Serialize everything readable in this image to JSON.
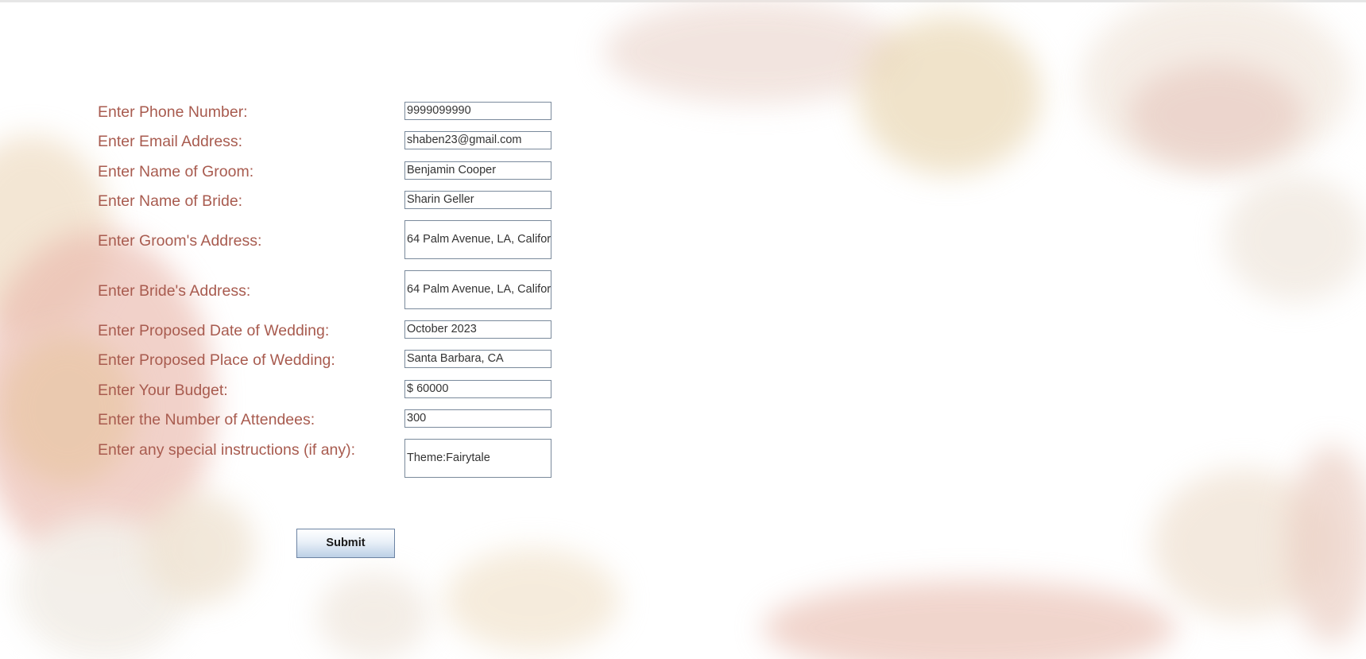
{
  "form": {
    "phone": {
      "label": "Enter Phone Number:",
      "value": "9999099990"
    },
    "email": {
      "label": "Enter Email Address:",
      "value": "shaben23@gmail.com"
    },
    "groom_name": {
      "label": "Enter Name of Groom:",
      "value": "Benjamin Cooper"
    },
    "bride_name": {
      "label": "Enter Name of Bride:",
      "value": "Sharin Geller"
    },
    "groom_address": {
      "label": "Enter Groom's Address:",
      "value": "64 Palm Avenue, LA, Califor"
    },
    "bride_address": {
      "label": "Enter Bride's Address:",
      "value": "64 Palm Avenue, LA, Califor"
    },
    "wedding_date": {
      "label": "Enter Proposed Date of Wedding:",
      "value": "October 2023"
    },
    "wedding_place": {
      "label": "Enter Proposed Place of Wedding:",
      "value": "Santa Barbara, CA"
    },
    "budget": {
      "label": "Enter Your Budget:",
      "value": "$ 60000"
    },
    "attendees": {
      "label": "Enter the Number of Attendees:",
      "value": "300"
    },
    "instructions": {
      "label": "Enter any special instructions (if any):",
      "value": "Theme:Fairytale"
    }
  },
  "submit_label": "Submit",
  "colors": {
    "label_text": "#a85b4f",
    "field_border": "#7a8a9c",
    "button_border": "#6c83a3"
  }
}
